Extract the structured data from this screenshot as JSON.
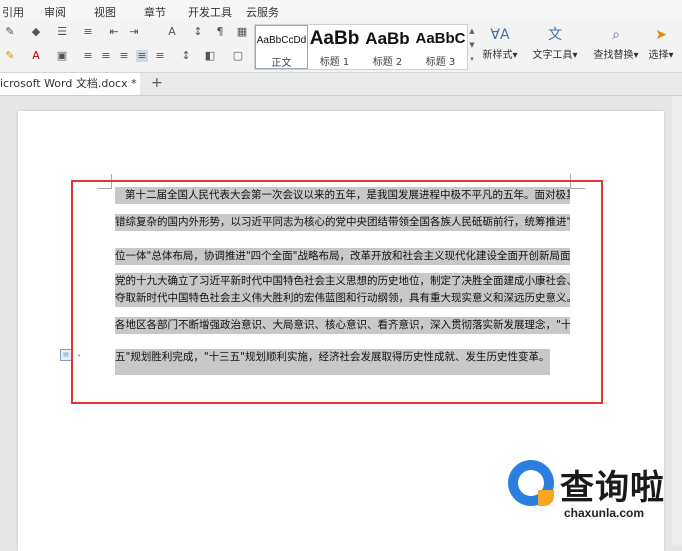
{
  "menubar": {
    "items": [
      "引用",
      "审阅",
      "视图",
      "章节",
      "开发工具",
      "云服务"
    ]
  },
  "styles": {
    "items": [
      {
        "sample": "AaBbCcDd",
        "label": "正文"
      },
      {
        "sample": "AaBb",
        "label": "标题 1"
      },
      {
        "sample": "AaBb",
        "label": "标题 2"
      },
      {
        "sample": "AaBbC",
        "label": "标题 3"
      }
    ]
  },
  "tools": {
    "new_style": "新样式",
    "text_tools": "文字工具",
    "find_replace": "查找替换",
    "select": "选择"
  },
  "tab": {
    "title": "icrosoft Word 文档.docx *",
    "new_tab_icon": "+"
  },
  "document": {
    "lines": [
      "第十二届全国人民代表大会第一次会议以来的五年，是我国发展进程中极不平凡的五年。面对极其",
      "错综复杂的国内外形势，以习近平同志为核心的党中央团结带领全国各族人民砥砺前行，统筹推进\"五",
      "位一体\"总体布局，协调推进\"四个全面\"战略布局，改革开放和社会主义现代化建设全面开创新局面。",
      "党的十九大确立了习近平新时代中国特色社会主义思想的历史地位，制定了决胜全面建成小康社会、",
      "夺取新时代中国特色社会主义伟大胜利的宏伟蓝图和行动纲领，具有重大现实意义和深远历史意义。",
      "各地区各部门不断增强政治意识、大局意识、核心意识、看齐意识，深入贯彻落实新发展理念，\"十二",
      "五\"规划胜利完成，\"十三五\"规划顺利实施，经济社会发展取得历史性成就、发生历史性变革。"
    ]
  },
  "watermark": {
    "text": "查询啦",
    "url": "chaxunla.com"
  },
  "colors": {
    "highlight": "#c8c8c8",
    "annotation_box": "#e03636",
    "brand_blue": "#2a7fe0",
    "brand_orange": "#f5a623"
  }
}
